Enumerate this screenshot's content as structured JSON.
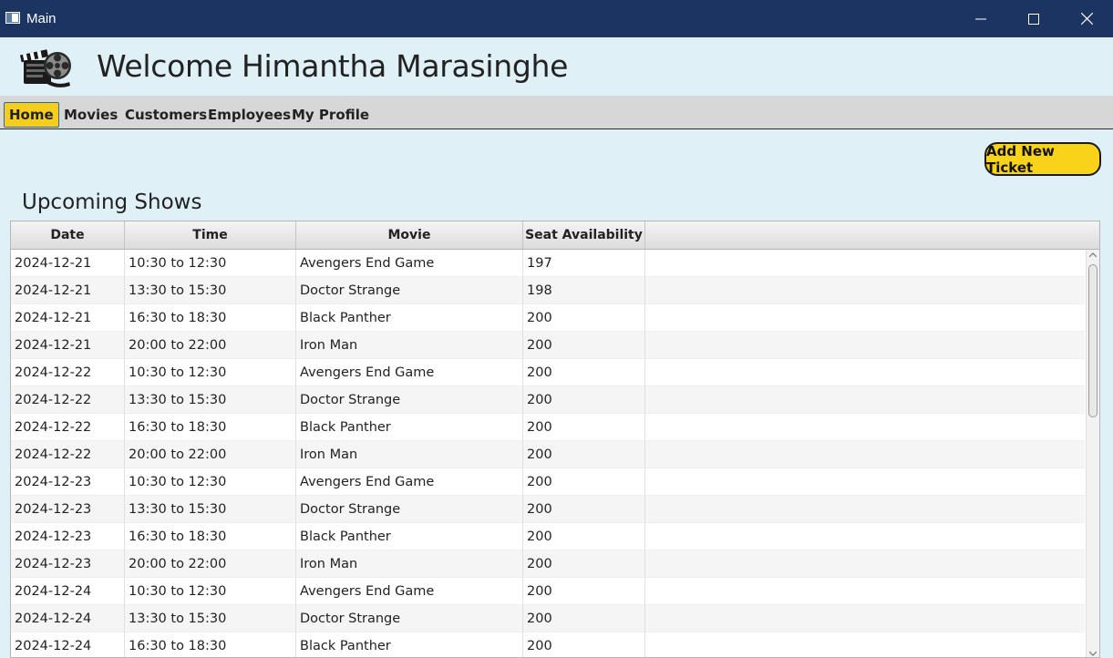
{
  "window": {
    "title": "Main"
  },
  "header": {
    "welcome": "Welcome Himantha Marasinghe"
  },
  "tabs": [
    {
      "label": "Home",
      "active": true
    },
    {
      "label": "Movies"
    },
    {
      "label": "Customers"
    },
    {
      "label": "Employees"
    },
    {
      "label": "My Profile"
    }
  ],
  "actions": {
    "add_ticket": "Add New Ticket"
  },
  "section": {
    "title": "Upcoming Shows"
  },
  "table": {
    "columns": [
      "Date",
      "Time",
      "Movie",
      "Seat Availability"
    ],
    "rows": [
      [
        "2024-12-21",
        "10:30 to 12:30",
        "Avengers End Game",
        "197"
      ],
      [
        "2024-12-21",
        "13:30 to 15:30",
        "Doctor Strange",
        "198"
      ],
      [
        "2024-12-21",
        "16:30 to 18:30",
        "Black Panther",
        "200"
      ],
      [
        "2024-12-21",
        "20:00 to 22:00",
        "Iron Man",
        "200"
      ],
      [
        "2024-12-22",
        "10:30 to 12:30",
        "Avengers End Game",
        "200"
      ],
      [
        "2024-12-22",
        "13:30 to 15:30",
        "Doctor Strange",
        "200"
      ],
      [
        "2024-12-22",
        "16:30 to 18:30",
        "Black Panther",
        "200"
      ],
      [
        "2024-12-22",
        "20:00 to 22:00",
        "Iron Man",
        "200"
      ],
      [
        "2024-12-23",
        "10:30 to 12:30",
        "Avengers End Game",
        "200"
      ],
      [
        "2024-12-23",
        "13:30 to 15:30",
        "Doctor Strange",
        "200"
      ],
      [
        "2024-12-23",
        "16:30 to 18:30",
        "Black Panther",
        "200"
      ],
      [
        "2024-12-23",
        "20:00 to 22:00",
        "Iron Man",
        "200"
      ],
      [
        "2024-12-24",
        "10:30 to 12:30",
        "Avengers End Game",
        "200"
      ],
      [
        "2024-12-24",
        "13:30 to 15:30",
        "Doctor Strange",
        "200"
      ],
      [
        "2024-12-24",
        "16:30 to 18:30",
        "Black Panther",
        "200"
      ]
    ]
  },
  "icons": {
    "app": "window-app-icon",
    "logo": "film-clapper-reel-icon",
    "minimize": "minimize-icon",
    "maximize": "maximize-icon",
    "close": "close-icon"
  },
  "colors": {
    "titlebar": "#1c3461",
    "background": "#dff0f7",
    "accent_yellow": "#f7cd1c",
    "tabbar": "#d7d7d7"
  }
}
